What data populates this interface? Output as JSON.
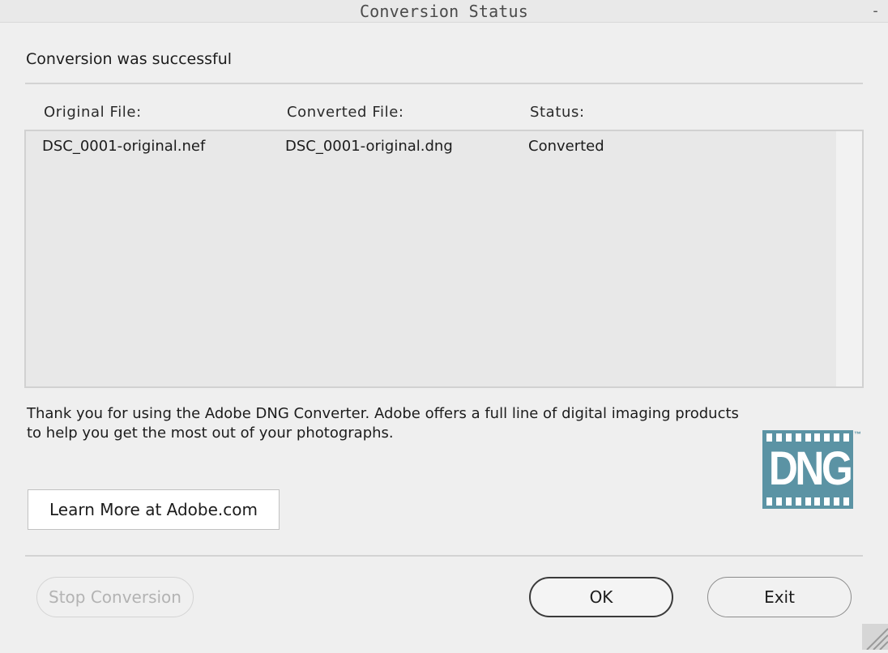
{
  "window": {
    "title": "Conversion Status",
    "minimize_glyph": "-"
  },
  "status_message": "Conversion was successful",
  "table": {
    "headers": [
      "Original File:",
      "Converted File:",
      "Status:"
    ],
    "rows": [
      [
        "DSC_0001-original.nef",
        "DSC_0001-original.dng",
        "Converted"
      ]
    ]
  },
  "thanks_text": "Thank you for using the Adobe DNG Converter.  Adobe offers a full line of digital imaging products to help you get the most out of your photographs.",
  "logo": {
    "text": "DNG",
    "trademark": "™",
    "color": "#5b93a4"
  },
  "buttons": {
    "learn_more": "Learn More at Adobe.com",
    "stop_conversion": "Stop Conversion",
    "ok": "OK",
    "exit": "Exit"
  },
  "icons": {
    "resize_grip": "resize-grip-icon"
  }
}
